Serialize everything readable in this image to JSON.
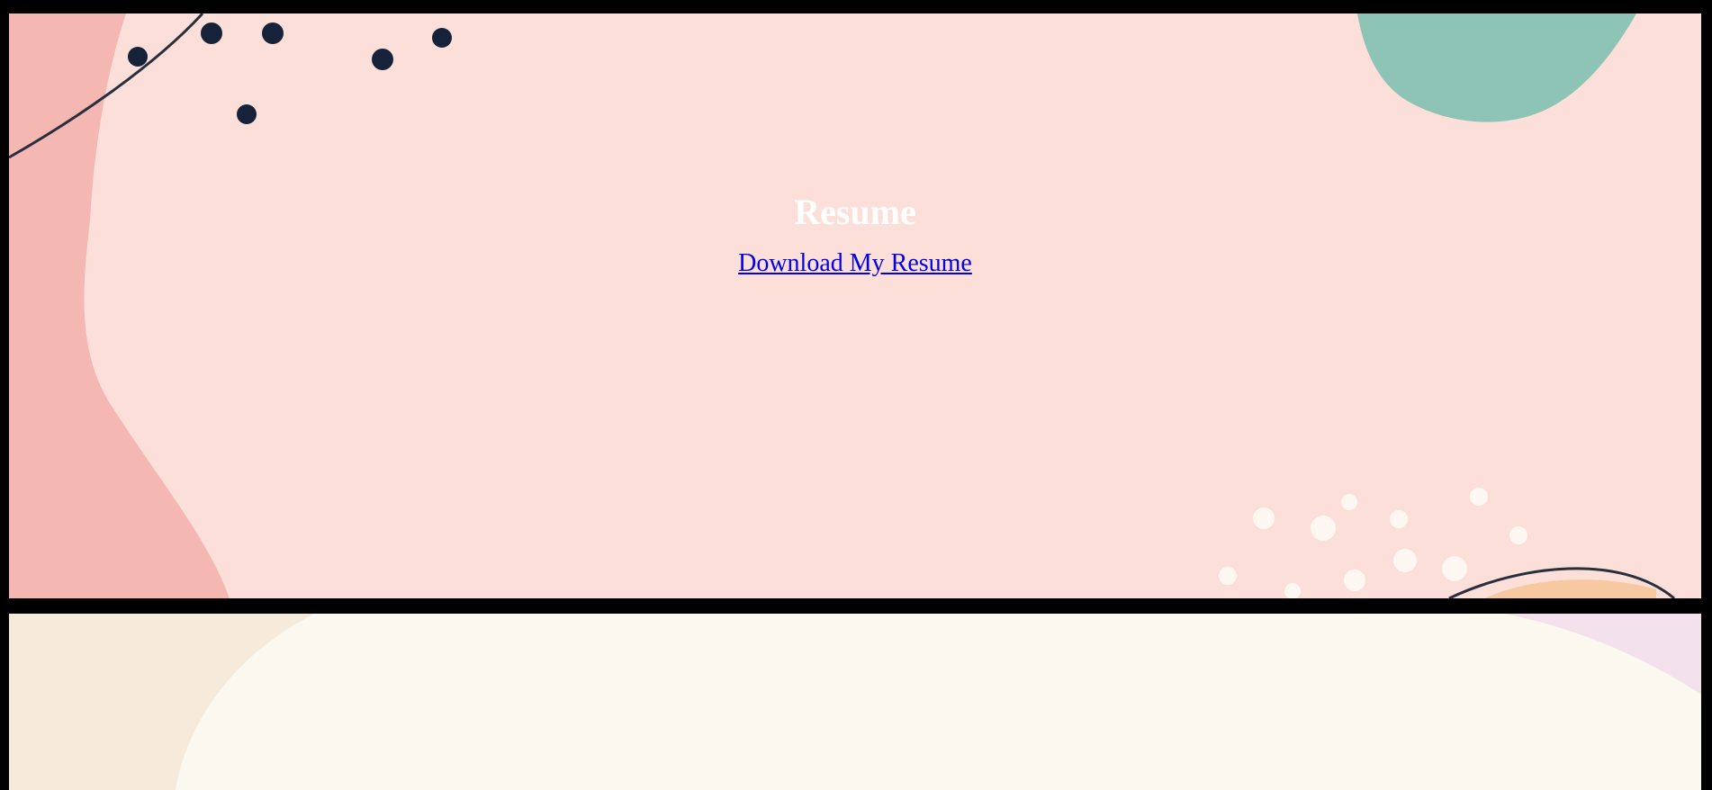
{
  "resume_section": {
    "title": "Resume",
    "download_link_label": "Download My Resume"
  },
  "colors": {
    "page_border": "#000000",
    "resume_bg": "#fcdfd8",
    "left_blob": "#f5b7b2",
    "teal_blob": "#8dc4b5",
    "dark_dots": "#15223a",
    "white_dots": "#fff8f2",
    "orange_blob": "#f8c9a0",
    "next_bg": "#fbf8f0",
    "next_left_blob": "#f6eadb",
    "next_right_blob": "#f3e2ec",
    "title_text": "#ffffff",
    "link_text": "#0000ee"
  },
  "decorations": {
    "resume_section": [
      "left-pink-blob",
      "top-left-dark-dots",
      "top-left-curve-line",
      "top-right-teal-blob",
      "bottom-right-white-dots",
      "bottom-right-orange-blob",
      "bottom-right-curve-line"
    ],
    "next_section": [
      "left-beige-blob",
      "center-cream-oval",
      "right-lilac-blob"
    ]
  }
}
